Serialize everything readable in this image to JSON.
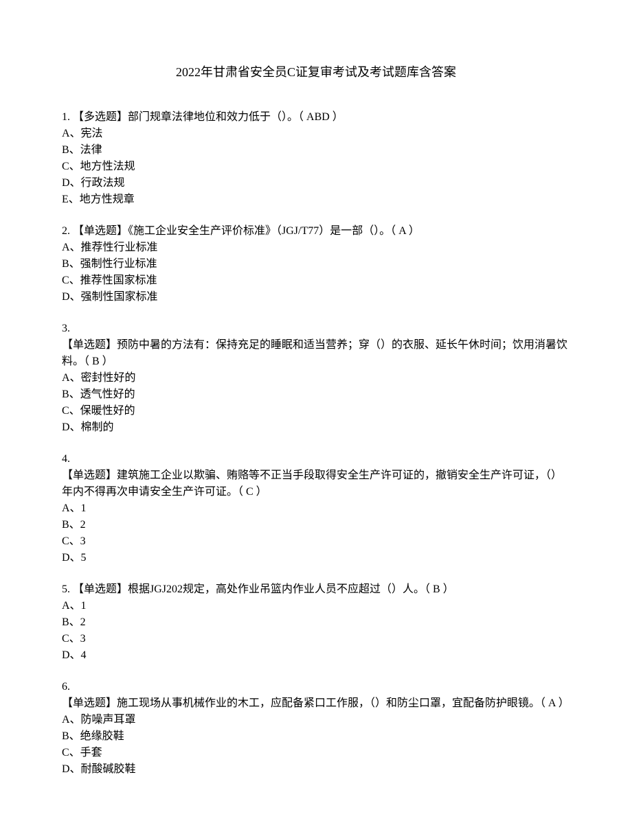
{
  "title": "2022年甘肃省安全员C证复审考试及考试题库含答案",
  "questions": [
    {
      "num": "1. ",
      "type": "【多选题】",
      "text": "部门规章法律地位和效力低于（）。（  ABD  ）",
      "options": [
        "A、宪法",
        "B、法律",
        "C、地方性法规",
        "D、行政法规",
        "E、地方性规章"
      ]
    },
    {
      "num": "2. ",
      "type": "【单选题】",
      "text": "《施工企业安全生产评价标准》（JGJ/T77）是一部（）。（  A  ）",
      "options": [
        "A、推荐性行业标准",
        "B、强制性行业标准",
        "C、推荐性国家标准",
        "D、强制性国家标准"
      ]
    },
    {
      "num": "3.",
      "type": "【单选题】",
      "text": "预防中暑的方法有：保持充足的睡眠和适当营养；穿（）的衣服、延长午休时间；饮用消暑饮料。（  B  ）",
      "multiline": true,
      "options": [
        "A、密封性好的",
        "B、透气性好的",
        "C、保暖性好的",
        "D、棉制的"
      ]
    },
    {
      "num": "4.",
      "type": "【单选题】",
      "text": "建筑施工企业以欺骗、贿赂等不正当手段取得安全生产许可证的，撤销安全生产许可证，（）年内不得再次申请安全生产许可证。（  C  ）",
      "multiline": true,
      "options": [
        "A、1",
        "B、2",
        "C、3",
        "D、5"
      ]
    },
    {
      "num": "5. ",
      "type": "【单选题】",
      "text": "根据JGJ202规定，高处作业吊篮内作业人员不应超过（）人。（  B  ）",
      "options": [
        "A、1",
        "B、2",
        "C、3",
        "D、4"
      ]
    },
    {
      "num": "6.",
      "type": "【单选题】",
      "text": "施工现场从事机械作业的木工，应配备紧口工作服，（）和防尘口罩，宜配备防护眼镜。（  A  ）",
      "multiline": true,
      "options": [
        "A、防噪声耳罩",
        "B、绝缘胶鞋",
        "C、手套",
        "D、耐酸碱胶鞋"
      ]
    }
  ]
}
